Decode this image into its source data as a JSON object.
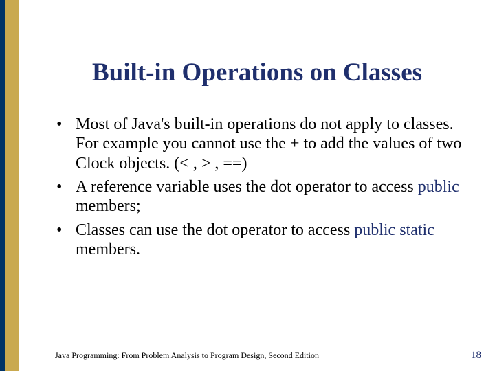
{
  "colors": {
    "accent": "#1f2f6d",
    "gold": "#c9a94f",
    "navy": "#003366"
  },
  "title": "Built-in Operations on Classes",
  "bullets": {
    "b1a": "Most of Java's built-in operations do not apply to classes. For example you cannot use the + to add the values of two Clock objects. (< , > , ==)",
    "b2a": "A reference variable uses the dot operator to access ",
    "b2kw": "public",
    "b2b": " members;",
    "b3a": "Classes can use the dot operator to access ",
    "b3kw": "public static",
    "b3b": " members."
  },
  "footer": {
    "text": "Java Programming: From Problem Analysis to Program Design, Second Edition",
    "page": "18"
  }
}
